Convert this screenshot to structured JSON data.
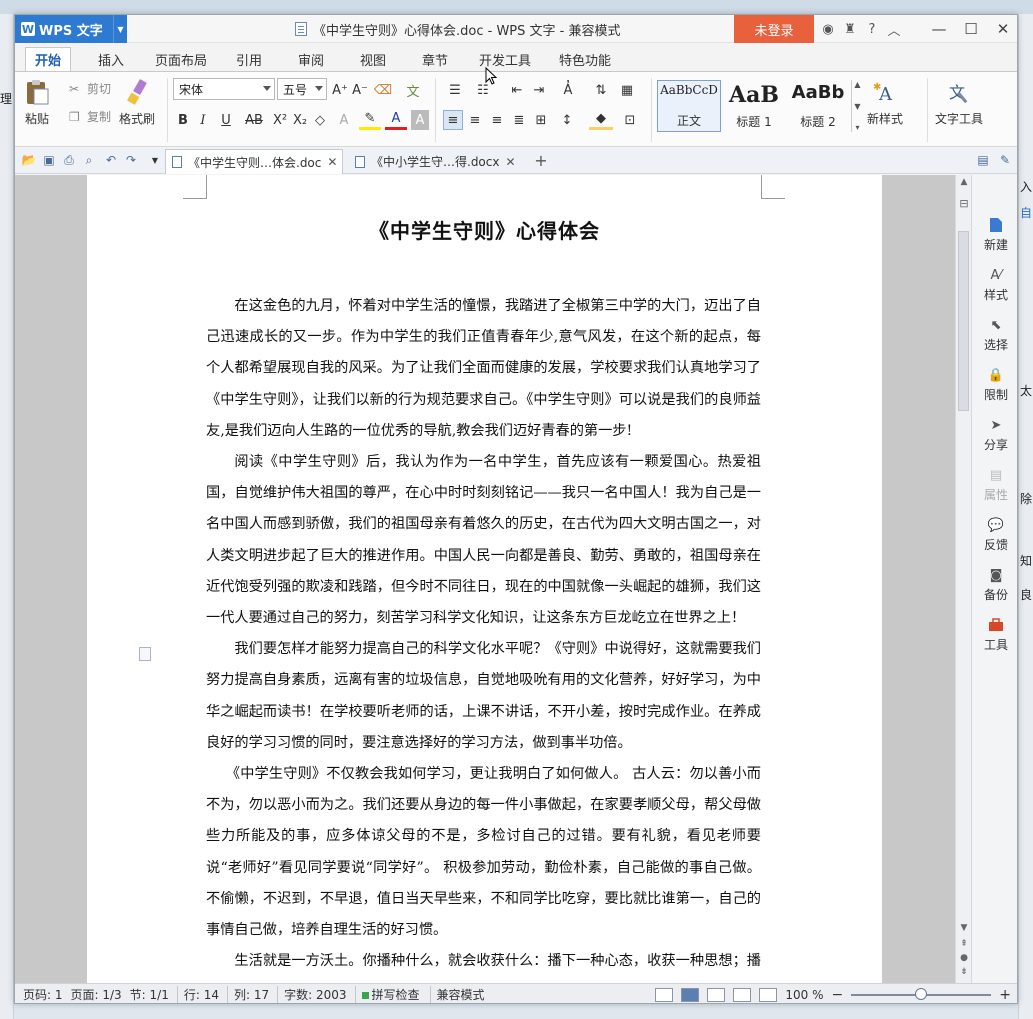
{
  "app": {
    "name": "WPS 文字",
    "window_title": "《中学生守则》心得体会.doc - WPS 文字 - 兼容模式",
    "login_label": "未登录",
    "help_label": "?"
  },
  "ribbon_tabs": [
    "开始",
    "插入",
    "页面布局",
    "引用",
    "审阅",
    "视图",
    "章节",
    "开发工具",
    "特色功能"
  ],
  "ribbon": {
    "paste_label": "粘贴",
    "cut_label": "剪切",
    "copy_label": "复制",
    "format_painter_label": "格式刷",
    "font_name": "宋体",
    "font_size": "五号",
    "styles": [
      {
        "preview": "AaBbCcD",
        "label": "正文"
      },
      {
        "preview": "AaB",
        "label": "标题 1"
      },
      {
        "preview": "AaBb",
        "label": "标题 2"
      }
    ],
    "new_style_label": "新样式",
    "text_tools_label": "文字工具"
  },
  "doc_tabs": [
    {
      "label": "《中学生守则…体会.doc",
      "active": true
    },
    {
      "label": "《中小学生守…得.docx",
      "active": false
    }
  ],
  "document": {
    "heading": "《中学生守则》心得体会",
    "paragraphs": [
      "在这金色的九月，怀着对中学生活的憧憬，我踏进了全椒第三中学的大门，迈出了自己迅速成长的又一步。作为中学生的我们正值青春年少,意气风发，在这个新的起点，每个人都希望展现自我的风采。为了让我们全面而健康的发展，学校要求我们认真地学习了《中学生守则》，让我们以新的行为规范要求自己。《中学生守则》可以说是我们的良师益友,是我们迈向人生路的一位优秀的导航,教会我们迈好青春的第一步!",
      "阅读《中学生守则》后，我认为作为一名中学生，首先应该有一颗爱国心。热爱祖国，自觉维护伟大祖国的尊严，在心中时时刻刻铭记——我只一名中国人！我为自己是一名中国人而感到骄傲，我们的祖国母亲有着悠久的历史，在古代为四大文明古国之一，对人类文明进步起了巨大的推进作用。中国人民一向都是善良、勤劳、勇敢的，祖国母亲在近代饱受列强的欺凌和践踏，但今时不同往日，现在的中国就像一头崛起的雄狮，我们这一代人要通过自己的努力，刻苦学习科学文化知识，让这条东方巨龙屹立在世界之上！",
      "我们要怎样才能努力提高自己的科学文化水平呢？《守则》中说得好，这就需要我们努力提高自身素质，远离有害的垃圾信息，自觉地吸吮有用的文化营养，好好学习，为中华之崛起而读书！在学校要听老师的话，上课不讲话，不开小差，按时完成作业。在养成良好的学习习惯的同时，要注意选择好的学习方法，做到事半功倍。",
      "《中学生守则》不仅教会我如何学习，更让我明白了如何做人。 古人云：勿以善小而不为，勿以恶小而为之。我们还要从身边的每一件小事做起，在家要孝顺父母，帮父母做些力所能及的事，应多体谅父母的不是，多检讨自己的过错。要有礼貌，看见老师要说“老师好”看见同学要说“同学好”。 积极参加劳动，勤俭朴素，自己能做的事自己做。不偷懒，不迟到，不早退，值日当天早些来，不和同学比吃穿，要比就比谁第一，自己的事情自己做，培养自理生活的好习惯。",
      "生活就是一方沃土。你播种什么，就会收获什么：播下一种心态，收获一种思想；播下"
    ]
  },
  "task_pane": [
    {
      "label": "新建",
      "icon": "new-doc-icon",
      "enabled": true
    },
    {
      "label": "样式",
      "icon": "style-icon",
      "enabled": true
    },
    {
      "label": "选择",
      "icon": "select-icon",
      "enabled": true
    },
    {
      "label": "限制",
      "icon": "restrict-icon",
      "enabled": true
    },
    {
      "label": "分享",
      "icon": "share-icon",
      "enabled": true
    },
    {
      "label": "属性",
      "icon": "properties-icon",
      "enabled": false
    },
    {
      "label": "反馈",
      "icon": "feedback-icon",
      "enabled": true
    },
    {
      "label": "备份",
      "icon": "backup-icon",
      "enabled": true
    },
    {
      "label": "工具",
      "icon": "toolbox-icon",
      "enabled": true
    }
  ],
  "status": {
    "page_num": "页码: 1",
    "pages": "页面: 1/3",
    "section": "节: 1/1",
    "row": "行: 14",
    "col": "列: 17",
    "words": "字数: 2003",
    "spell_check": "拼写检查",
    "compat_mode": "兼容模式",
    "zoom": "100 %",
    "zoom_fraction": 0.5
  },
  "background_fragments": [
    "理",
    "入",
    "自",
    "太",
    "除",
    "知",
    "良"
  ],
  "colors": {
    "app_blue": "#2e7ad1",
    "login_orange": "#e8603c",
    "active_tab_blue": "#1f5fb4",
    "toolbox_red": "#d9472b"
  }
}
